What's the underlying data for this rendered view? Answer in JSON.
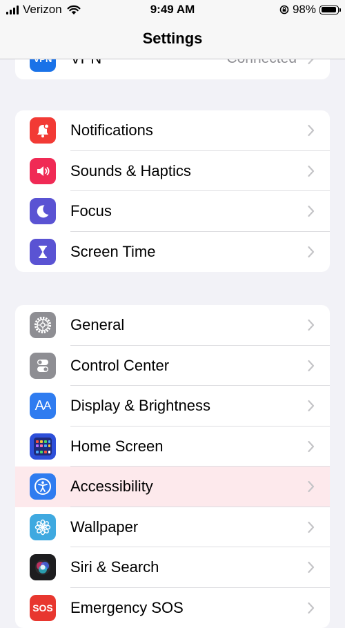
{
  "status_bar": {
    "carrier": "Verizon",
    "time": "9:49 AM",
    "battery": "98%"
  },
  "nav": {
    "title": "Settings"
  },
  "group0": [
    {
      "label": "VPN",
      "detail": "Connected",
      "icon": "vpn-icon",
      "color": "#1a72e8"
    }
  ],
  "group1": [
    {
      "label": "Notifications",
      "icon": "bell-icon",
      "color": "#f23a35"
    },
    {
      "label": "Sounds & Haptics",
      "icon": "speaker-icon",
      "color": "#f02a55"
    },
    {
      "label": "Focus",
      "icon": "moon-icon",
      "color": "#5a53d3"
    },
    {
      "label": "Screen Time",
      "icon": "hourglass-icon",
      "color": "#5a53d3"
    }
  ],
  "group2": [
    {
      "label": "General",
      "icon": "gear-icon",
      "color": "#8e8e93"
    },
    {
      "label": "Control Center",
      "icon": "toggles-icon",
      "color": "#8e8e93"
    },
    {
      "label": "Display & Brightness",
      "icon": "text-size-icon",
      "color": "#2f7cf0"
    },
    {
      "label": "Home Screen",
      "icon": "app-grid-icon",
      "color": "#2d4fd9"
    },
    {
      "label": "Accessibility",
      "icon": "accessibility-icon",
      "color": "#2f7cf0"
    },
    {
      "label": "Wallpaper",
      "icon": "flower-icon",
      "color": "#3fa9e0"
    },
    {
      "label": "Siri & Search",
      "icon": "siri-icon",
      "color": "#1d1d1f"
    },
    {
      "label": "Emergency SOS",
      "icon": "sos-icon",
      "color": "#e8372f"
    }
  ]
}
